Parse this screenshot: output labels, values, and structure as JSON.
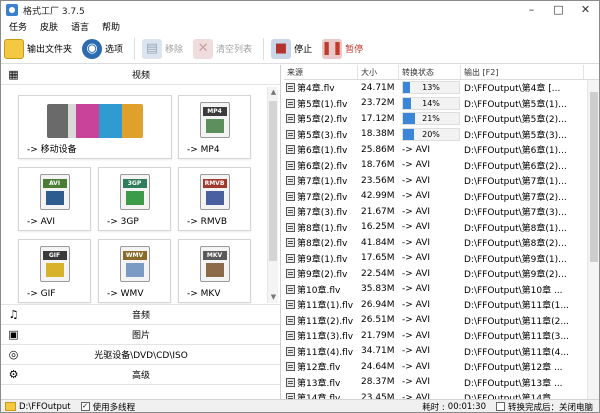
{
  "window": {
    "title": "格式工厂 3.7.5",
    "min": "–",
    "max": "□",
    "close": "✕"
  },
  "menu": [
    "任务",
    "皮肤",
    "语言",
    "帮助"
  ],
  "toolbar": {
    "output_folder": "输出文件夹",
    "options": "选项",
    "remove": "移除",
    "clear": "清空列表",
    "stop": "停止",
    "start": "暂停"
  },
  "left": {
    "video_header": "视频",
    "tiles": [
      {
        "label": "-> 移动设备",
        "icon": "mobile-device-icon"
      },
      {
        "label": "-> MP4",
        "icon": "mp4-icon",
        "band": "MP4"
      },
      {
        "label": "-> AVI",
        "icon": "avi-icon",
        "band": "AVI"
      },
      {
        "label": "-> 3GP",
        "icon": "3gp-icon",
        "band": "3GP"
      },
      {
        "label": "-> RMVB",
        "icon": "rmvb-icon",
        "band": "RMVB"
      },
      {
        "label": "-> GIF",
        "icon": "gif-icon",
        "band": "GIF"
      },
      {
        "label": "-> WMV",
        "icon": "wmv-icon",
        "band": "WMV"
      },
      {
        "label": "-> MKV",
        "icon": "mkv-icon",
        "band": "MKV"
      }
    ],
    "categories": [
      {
        "label": "音频",
        "icon": "audio-icon"
      },
      {
        "label": "图片",
        "icon": "picture-icon"
      },
      {
        "label": "光驱设备\\DVD\\CD\\ISO",
        "icon": "optical-drive-icon"
      },
      {
        "label": "高级",
        "icon": "advanced-icon"
      }
    ]
  },
  "grid": {
    "headers": [
      "来源",
      "大小",
      "转换状态",
      "输出 [F2]"
    ],
    "rows": [
      {
        "name": "第4章.flv",
        "size": "24.71M",
        "status": "13%",
        "progress": 13,
        "out": "D:\\FFOutput\\第4章 [..."
      },
      {
        "name": "第5章(1).flv",
        "size": "23.72M",
        "status": "14%",
        "progress": 14,
        "out": "D:\\FFOutput\\第5章(1)..."
      },
      {
        "name": "第5章(2).flv",
        "size": "17.12M",
        "status": "21%",
        "progress": 21,
        "out": "D:\\FFOutput\\第5章(2)..."
      },
      {
        "name": "第5章(3).flv",
        "size": "18.38M",
        "status": "20%",
        "progress": 20,
        "out": "D:\\FFOutput\\第5章(3)..."
      },
      {
        "name": "第6章(1).flv",
        "size": "25.86M",
        "status": "-> AVI",
        "out": "D:\\FFOutput\\第6章(1)..."
      },
      {
        "name": "第6章(2).flv",
        "size": "18.76M",
        "status": "-> AVI",
        "out": "D:\\FFOutput\\第6章(2)..."
      },
      {
        "name": "第7章(1).flv",
        "size": "23.56M",
        "status": "-> AVI",
        "out": "D:\\FFOutput\\第7章(1)..."
      },
      {
        "name": "第7章(2).flv",
        "size": "42.99M",
        "status": "-> AVI",
        "out": "D:\\FFOutput\\第7章(2)..."
      },
      {
        "name": "第7章(3).flv",
        "size": "21.67M",
        "status": "-> AVI",
        "out": "D:\\FFOutput\\第7章(3)..."
      },
      {
        "name": "第8章(1).flv",
        "size": "16.25M",
        "status": "-> AVI",
        "out": "D:\\FFOutput\\第8章(1)..."
      },
      {
        "name": "第8章(2).flv",
        "size": "41.84M",
        "status": "-> AVI",
        "out": "D:\\FFOutput\\第8章(2)..."
      },
      {
        "name": "第9章(1).flv",
        "size": "17.65M",
        "status": "-> AVI",
        "out": "D:\\FFOutput\\第9章(1)..."
      },
      {
        "name": "第9章(2).flv",
        "size": "22.54M",
        "status": "-> AVI",
        "out": "D:\\FFOutput\\第9章(2)..."
      },
      {
        "name": "第10章.flv",
        "size": "35.83M",
        "status": "-> AVI",
        "out": "D:\\FFOutput\\第10章 ..."
      },
      {
        "name": "第11章(1).flv",
        "size": "26.94M",
        "status": "-> AVI",
        "out": "D:\\FFOutput\\第11章(1..."
      },
      {
        "name": "第11章(2).flv",
        "size": "26.51M",
        "status": "-> AVI",
        "out": "D:\\FFOutput\\第11章(2..."
      },
      {
        "name": "第11章(3).flv",
        "size": "21.79M",
        "status": "-> AVI",
        "out": "D:\\FFOutput\\第11章(3..."
      },
      {
        "name": "第11章(4).flv",
        "size": "34.71M",
        "status": "-> AVI",
        "out": "D:\\FFOutput\\第11章(4..."
      },
      {
        "name": "第12章.flv",
        "size": "24.64M",
        "status": "-> AVI",
        "out": "D:\\FFOutput\\第12章 ..."
      },
      {
        "name": "第13章.flv",
        "size": "28.37M",
        "status": "-> AVI",
        "out": "D:\\FFOutput\\第13章 ..."
      },
      {
        "name": "第14章.flv",
        "size": "23.45M",
        "status": "-> AVI",
        "out": "D:\\FFOutput\\第14章 ..."
      }
    ]
  },
  "status": {
    "folder": "D:\\FFOutput",
    "multithread": "使用多线程",
    "elapsed_label": "耗时 :",
    "elapsed": "00:01:30",
    "shutdown": "转换完成后：关闭电脑"
  },
  "colors": {
    "accent": "#3a86d8"
  }
}
